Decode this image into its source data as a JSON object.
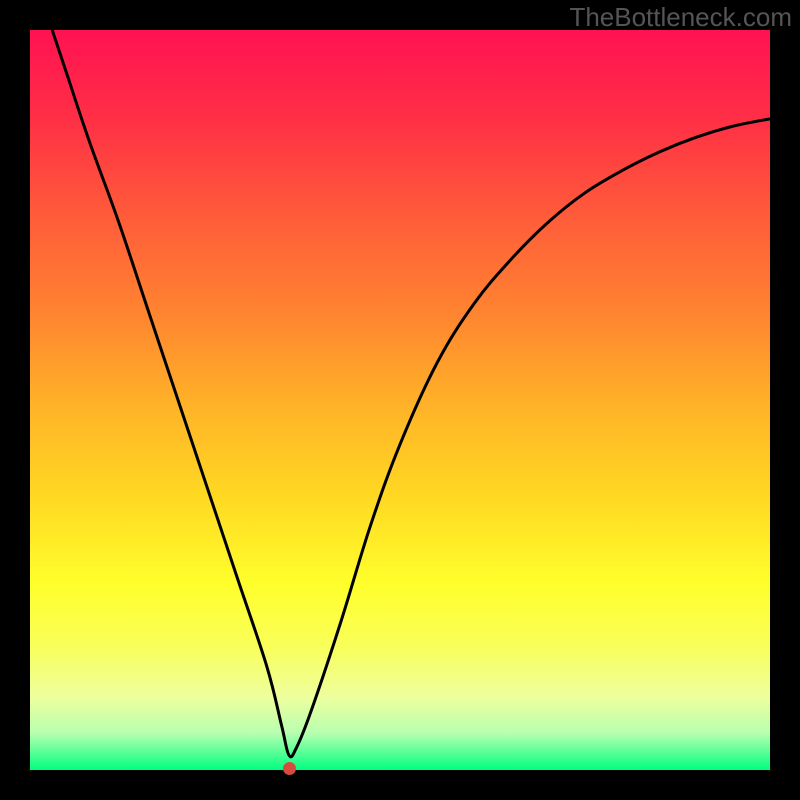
{
  "attribution": "TheBottleneck.com",
  "colors": {
    "frame": "#000000",
    "attribution_text": "#555555",
    "gradient_stops": [
      {
        "offset": 0.0,
        "color": "#ff1252"
      },
      {
        "offset": 0.12,
        "color": "#ff2f45"
      },
      {
        "offset": 0.25,
        "color": "#ff5b3a"
      },
      {
        "offset": 0.38,
        "color": "#ff8330"
      },
      {
        "offset": 0.5,
        "color": "#ffb028"
      },
      {
        "offset": 0.63,
        "color": "#ffd822"
      },
      {
        "offset": 0.75,
        "color": "#ffff2c"
      },
      {
        "offset": 0.83,
        "color": "#f9ff58"
      },
      {
        "offset": 0.9,
        "color": "#eeff9c"
      },
      {
        "offset": 0.95,
        "color": "#b8ffb0"
      },
      {
        "offset": 1.0,
        "color": "#00ff80"
      }
    ],
    "curve": "#000000",
    "marker": "#d84a3e"
  },
  "chart_data": {
    "type": "line",
    "title": "",
    "xlabel": "",
    "ylabel": "",
    "xlim": [
      0,
      100
    ],
    "ylim": [
      0,
      100
    ],
    "series": [
      {
        "name": "bottleneck-curve",
        "x": [
          3,
          5,
          8,
          12,
          16,
          20,
          24,
          28,
          32,
          34,
          35,
          36,
          38,
          42,
          46,
          50,
          55,
          60,
          65,
          70,
          75,
          80,
          85,
          90,
          95,
          100
        ],
        "y": [
          100,
          94,
          85,
          74,
          62,
          50,
          38,
          26,
          14,
          6,
          2,
          3,
          8,
          20,
          33,
          44,
          55,
          63,
          69,
          74,
          78,
          81,
          83.5,
          85.5,
          87,
          88
        ]
      }
    ],
    "marker": {
      "x": 35,
      "y": 0
    }
  }
}
